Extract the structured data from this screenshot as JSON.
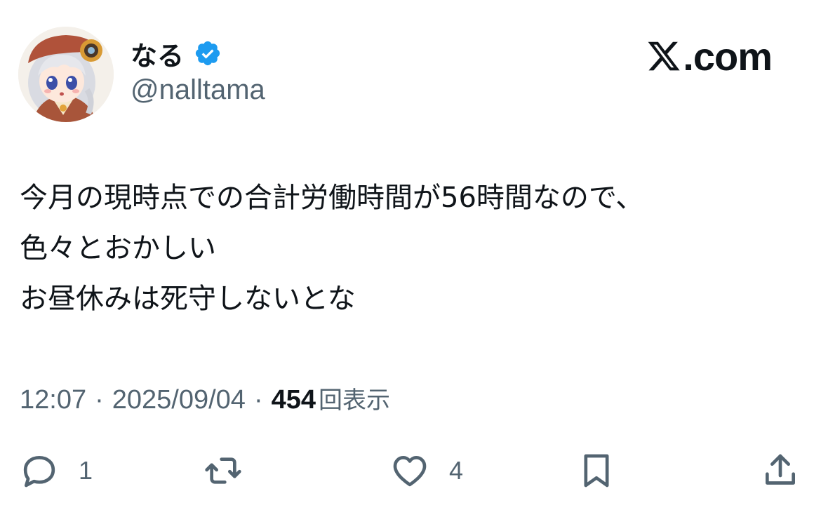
{
  "author": {
    "display_name": "なる",
    "handle": "@nalltama",
    "verified": true
  },
  "brand": {
    "label": ".com",
    "logo": "x-logo-icon"
  },
  "tweet": {
    "lines": [
      "今月の現時点での合計労働時間が56時間なので、",
      "色々とおかしい",
      "お昼休みは死守しないとな"
    ]
  },
  "meta": {
    "time": "12:07",
    "separator": "·",
    "date": "2025/09/04",
    "views_count": "454",
    "views_label": "回表示"
  },
  "actions": {
    "reply": {
      "icon": "reply-icon",
      "count": "1"
    },
    "repost": {
      "icon": "repost-icon",
      "count": ""
    },
    "like": {
      "icon": "heart-icon",
      "count": "4"
    },
    "bookmark": {
      "icon": "bookmark-icon"
    },
    "share": {
      "icon": "share-icon"
    }
  },
  "colors": {
    "text_primary": "#0f1419",
    "text_secondary": "#536471",
    "verified_blue": "#1d9bf0"
  }
}
